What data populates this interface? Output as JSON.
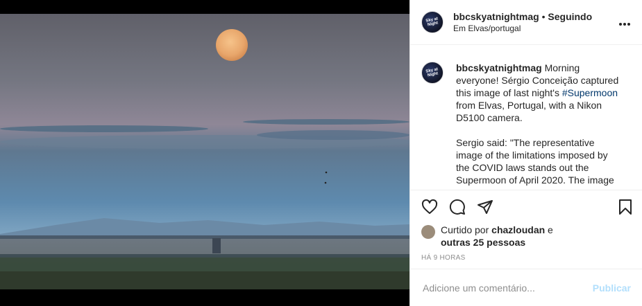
{
  "post": {
    "username": "bbcskyatnightmag",
    "separator": "•",
    "follow_status": "Seguindo",
    "location": "Em Elvas/portugal",
    "avatar_text": "Sky at Night",
    "more_icon": "more-horizontal-icon",
    "photo_alt": "Supermoon over Elvas, Portugal"
  },
  "caption": {
    "username": "bbcskyatnightmag",
    "text_part1": " Morning everyone! Sérgio Conceição captured this image of last night's ",
    "hashtag": "#Supermoon",
    "text_part2": " from Elvas, Portugal, with a Nikon D5100 camera.",
    "paragraph2": "Sergio said: \"The representative image of the limitations imposed by the COVID laws stands out the Supermoon of April 2020. The image"
  },
  "actions": {
    "like_icon": "heart-icon",
    "comment_icon": "comment-icon",
    "share_icon": "send-icon",
    "save_icon": "bookmark-icon"
  },
  "likes": {
    "prefix": "Curtido por ",
    "user": "chazloudan",
    "conj": " e",
    "others": "outras 25 pessoas"
  },
  "timestamp": "HÁ 9 HORAS",
  "comment": {
    "placeholder": "Adicione um comentário...",
    "post_label": "Publicar"
  },
  "colors": {
    "link": "#00376b",
    "post_button": "#b2dffc",
    "muted": "#8e8e8e",
    "text": "#262626"
  }
}
